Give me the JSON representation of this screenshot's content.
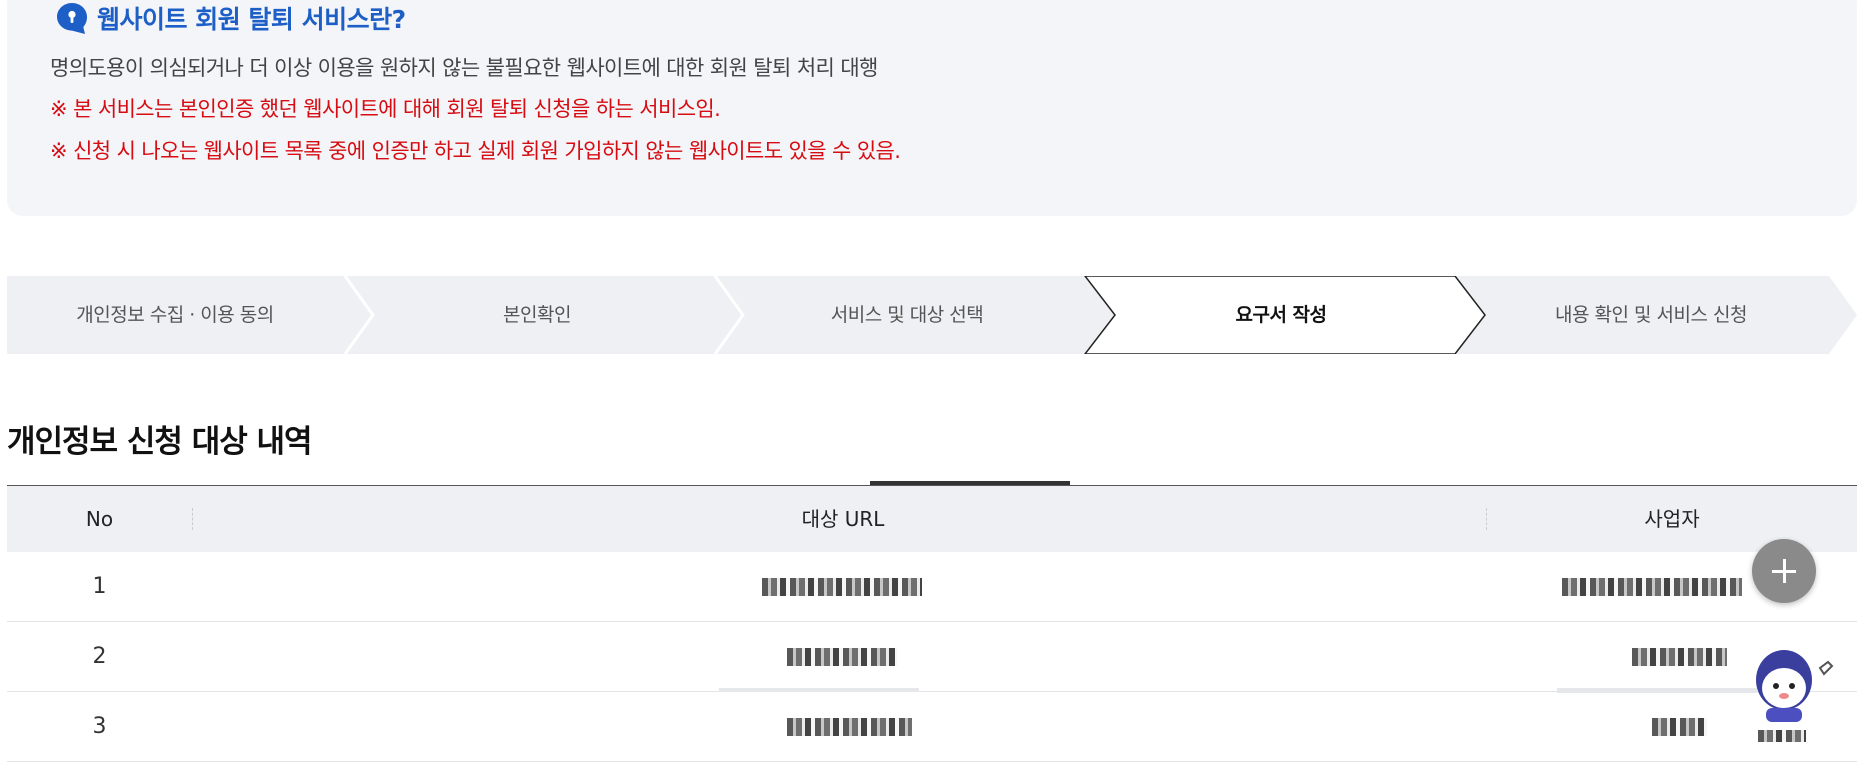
{
  "info": {
    "title": "웹사이트 회원 탈퇴 서비스란?",
    "description": "명의도용이 의심되거나 더 이상 이용을 원하지 않는 불필요한 웹사이트에 대한 회원 탈퇴 처리 대행",
    "notices": [
      "※ 본 서비스는 본인인증 했던 웹사이트에 대해 회원 탈퇴 신청을 하는 서비스임.",
      "※ 신청 시 나오는 웹사이트 목록 중에 인증만 하고 실제 회원 가입하지 않는 웹사이트도 있을 수 있음."
    ],
    "icon": "speech-bubble-keyhole-icon"
  },
  "steps": [
    {
      "label": "개인정보 수집 · 이용 동의",
      "active": false
    },
    {
      "label": "본인확인",
      "active": false
    },
    {
      "label": "서비스 및 대상 선택",
      "active": false
    },
    {
      "label": "요구서 작성",
      "active": true
    },
    {
      "label": "내용 확인 및 서비스 신청",
      "active": false
    }
  ],
  "section": {
    "title": "개인정보 신청 대상 내역"
  },
  "table": {
    "columns": [
      "No",
      "대상 URL",
      "사업자"
    ],
    "rows": [
      {
        "no": "1"
      },
      {
        "no": "2"
      },
      {
        "no": "3"
      }
    ]
  },
  "floating": {
    "plus_icon": "plus-icon",
    "chatbot_icon": "chatbot-mascot-icon"
  },
  "colors": {
    "title_blue": "#1d5fc7",
    "notice_red": "#d70c12",
    "info_bg": "#f3f5f8",
    "step_bg": "#eef0f3"
  }
}
